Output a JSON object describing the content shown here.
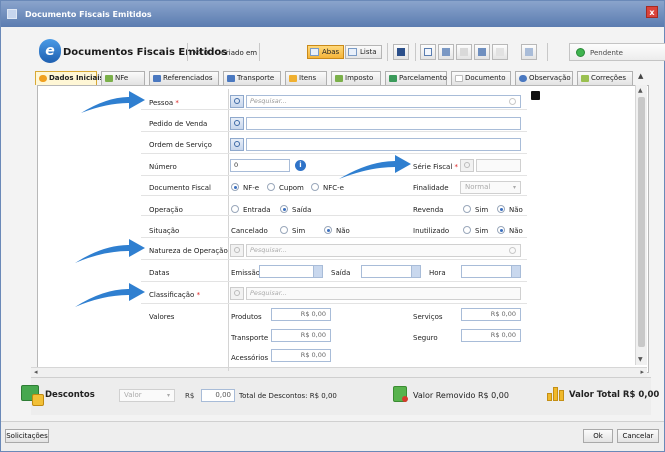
{
  "window": {
    "title": "Documento Fiscais Emitidos"
  },
  "toolbar": {
    "app_title": "Documentos Fiscais Emitidos",
    "number_label": "Nº 0",
    "created_label": "Criado em",
    "view_tabs_label": "Abas",
    "view_list_label": "Lista",
    "status_label": "Pendente"
  },
  "tabs": [
    {
      "label": "Dados Iniciais",
      "icon": "green-circle-icon",
      "color": "#f0a020",
      "active": true
    },
    {
      "label": "NFe",
      "icon": "nfe-icon",
      "color": "#7bb04a"
    },
    {
      "label": "Referenciados",
      "icon": "referenced-icon",
      "color": "#4a78c0"
    },
    {
      "label": "Transporte",
      "icon": "truck-icon",
      "color": "#4a78c0"
    },
    {
      "label": "Itens",
      "icon": "items-icon",
      "color": "#f0b030"
    },
    {
      "label": "Imposto",
      "icon": "tax-icon",
      "color": "#7bb04a"
    },
    {
      "label": "Parcelamento",
      "icon": "installments-icon",
      "color": "#3a9a5a"
    },
    {
      "label": "Documento",
      "icon": "document-icon",
      "color": "#cccccc"
    },
    {
      "label": "Observação",
      "icon": "note-icon",
      "color": "#4a78c0"
    },
    {
      "label": "Correções",
      "icon": "corrections-icon",
      "color": "#9ac050"
    }
  ],
  "form": {
    "pessoa": {
      "label": "Pessoa",
      "placeholder": "Pesquisar..."
    },
    "pedido_venda": {
      "label": "Pedido de Venda"
    },
    "ordem_servico": {
      "label": "Ordem de Serviço"
    },
    "numero": {
      "label": "Número",
      "value": "0"
    },
    "serie_fiscal": {
      "label": "Série Fiscal"
    },
    "documento_fiscal": {
      "label": "Documento Fiscal",
      "options": [
        "NF-e",
        "Cupom",
        "NFC-e"
      ]
    },
    "finalidade": {
      "label": "Finalidade",
      "value": "Normal"
    },
    "operacao": {
      "label": "Operação",
      "options": [
        "Entrada",
        "Saída"
      ]
    },
    "revenda": {
      "label": "Revenda",
      "options": [
        "Sim",
        "Não"
      ]
    },
    "situacao": {
      "label": "Situação",
      "cancelado_label": "Cancelado",
      "options": [
        "Sim",
        "Não"
      ]
    },
    "inutilizado": {
      "label": "Inutilizado",
      "options": [
        "Sim",
        "Não"
      ]
    },
    "natureza_operacao": {
      "label": "Natureza de Operação",
      "placeholder": "Pesquisar..."
    },
    "datas": {
      "label": "Datas",
      "emissao_label": "Emissão",
      "saida_label": "Saída",
      "hora_label": "Hora"
    },
    "classificacao": {
      "label": "Classificação",
      "placeholder": "Pesquisar..."
    },
    "valores": {
      "label": "Valores",
      "produtos_label": "Produtos",
      "produtos_value": "R$ 0,00",
      "servicos_label": "Serviços",
      "servicos_value": "R$ 0,00",
      "transporte_label": "Transporte",
      "transporte_value": "R$ 0,00",
      "seguro_label": "Seguro",
      "seguro_value": "R$ 0,00",
      "acessorios_label": "Acessórios",
      "acessorios_value": "R$ 0,00"
    }
  },
  "footer": {
    "descontos_label": "Descontos",
    "valor_select": "Valor",
    "rs_label": "R$",
    "desconto_value": "0,00",
    "total_descontos": "Total de Descontos:  R$ 0,00",
    "valor_removido": "Valor Removido R$ 0,00",
    "valor_total": "Valor Total R$ 0,00"
  },
  "buttons": {
    "solicitacoes": "Solicitações",
    "ok": "Ok",
    "cancelar": "Cancelar"
  },
  "colors": {
    "accent": "#2a6fc9",
    "title_bar": "#6c8bbd",
    "arrow": "#2f7fd0"
  }
}
